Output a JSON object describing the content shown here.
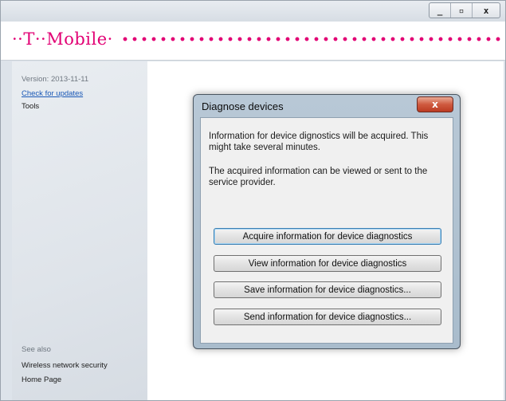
{
  "window": {
    "controls": [
      "_",
      "▫",
      "x"
    ]
  },
  "brand": {
    "logo": "··T··Mobile·"
  },
  "sidebar": {
    "version": "Version: 2013-11-11",
    "check_updates": "Check for updates",
    "tools": "Tools",
    "see_also": "See also",
    "links": [
      "Wireless network security",
      "Home Page"
    ]
  },
  "dialog": {
    "title": "Diagnose devices",
    "close_glyph": "x",
    "paragraph1": "Information for device dignostics will be acquired. This might take several minutes.",
    "paragraph2": "The acquired information can be viewed or sent to the service provider.",
    "buttons": [
      "Acquire information for device diagnostics",
      "View information for device diagnostics",
      "Save information for device diagnostics...",
      "Send information for device diagnostics..."
    ]
  }
}
